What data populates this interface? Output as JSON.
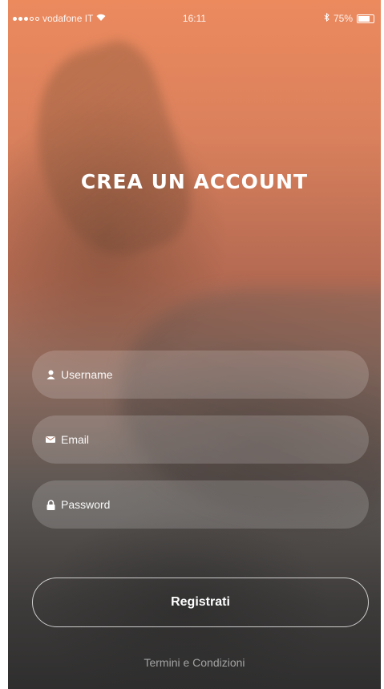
{
  "status_bar": {
    "carrier": "vodafone IT",
    "time": "16:11",
    "battery_percent": "75%",
    "battery_level": 0.75,
    "signal_bars_filled": 3,
    "signal_bars_total": 5,
    "icons": [
      "signal-dots-icon",
      "wifi-icon",
      "bluetooth-icon",
      "battery-icon"
    ]
  },
  "header": {
    "title": "CREA UN ACCOUNT"
  },
  "form": {
    "username": {
      "placeholder": "Username",
      "icon": "user-icon"
    },
    "email": {
      "placeholder": "Email",
      "icon": "mail-icon"
    },
    "password": {
      "placeholder": "Password",
      "icon": "lock-icon"
    }
  },
  "actions": {
    "register_label": "Registrati",
    "terms_label": "Termini e Condizioni"
  },
  "colors": {
    "background_top": "#ec8a5e",
    "background_bottom": "#2f2e2e",
    "text": "#ffffff"
  }
}
